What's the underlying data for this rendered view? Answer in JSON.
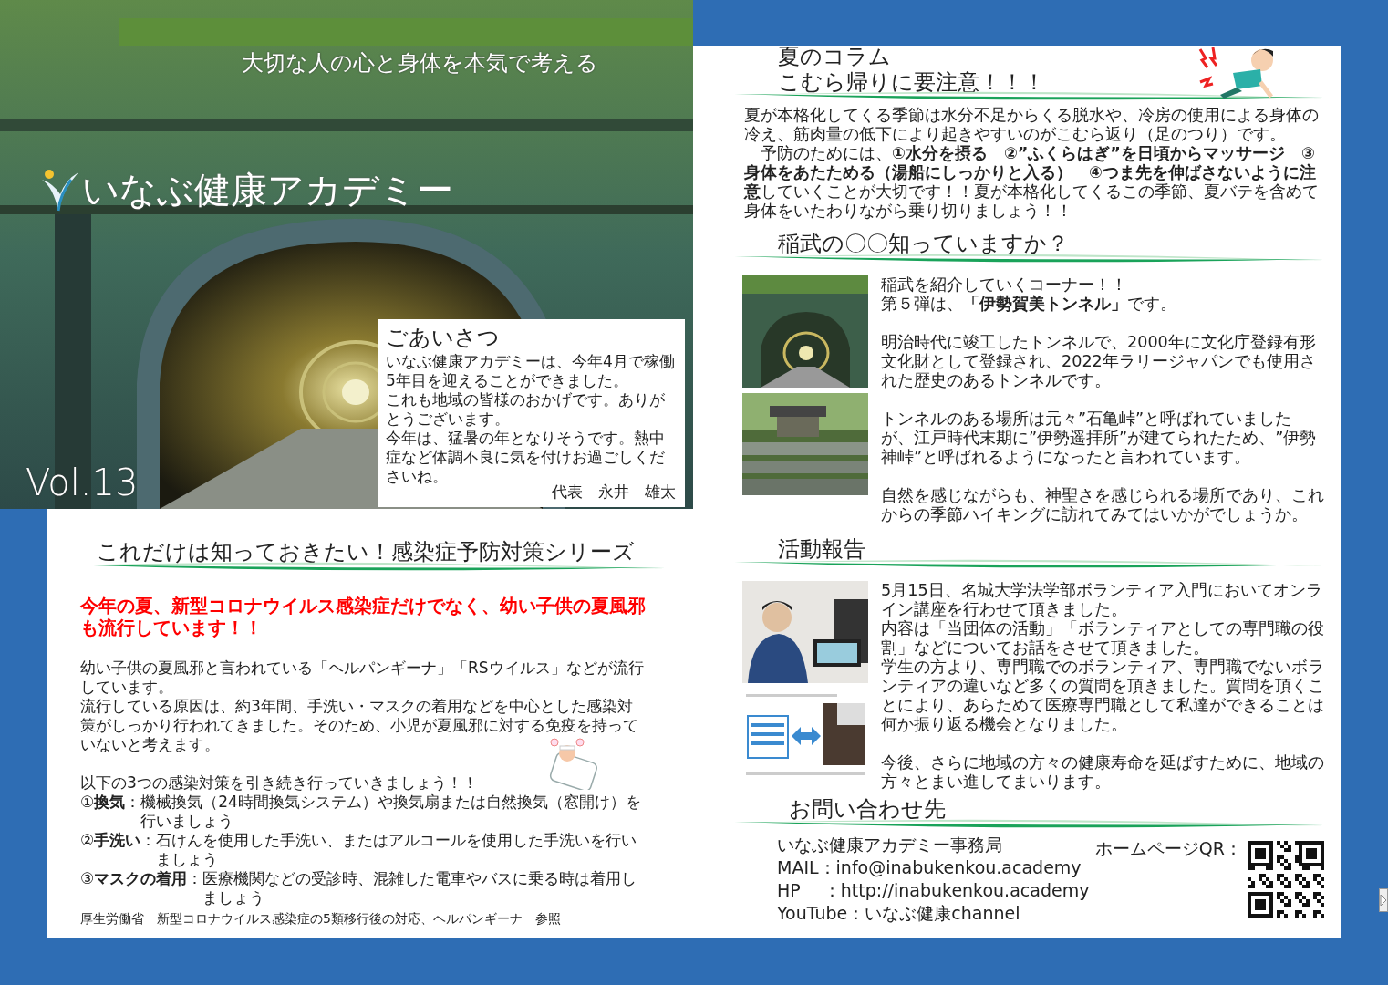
{
  "cover": {
    "tagline": "大切な人の心と身体を本気で考える",
    "title": "いなぶ健康アカデミー",
    "volume": "Vol.13",
    "greeting": {
      "title": "ごあいさつ",
      "paragraphs": [
        "いなぶ健康アカデミーは、今年4月で稼働5年目を迎えることができました。",
        "これも地域の皆様のおかげです。ありがとうございます。",
        "今年は、猛暑の年となりそうです。熱中症など体調不良に気を付けお過ごしくださいね。"
      ],
      "signature": "代表　永井　雄太"
    }
  },
  "infection_series": {
    "heading": "これだけは知っておきたい！感染症予防対策シリーズ",
    "alert": "今年の夏、新型コロナウイルス感染症だけでなく、幼い子供の夏風邪も流行しています！！",
    "paragraphs": [
      "幼い子供の夏風邪と言われている「ヘルパンギーナ」「RSウイルス」などが流行しています。",
      "流行している原因は、約3年間、手洗い・マスクの着用などを中心とした感染対策がしっかり行われてきました。そのため、小児が夏風邪に対する免疫を持っていないと考えます。"
    ],
    "list_intro": "以下の3つの感染対策を引き続き行っていきましょう！！",
    "measures": [
      {
        "label": "①**換気**：",
        "text": "機械換気（24時間換気システム）や換気扇または自然換気（窓開け）を行いましょう"
      },
      {
        "label": "②**手洗い**：",
        "text": "石けんを使用した手洗い、またはアルコールを使用した手洗いを行いましょう"
      },
      {
        "label": "③**マスクの着用**：",
        "text": "医療機関などの受診時、混雑した電車やバスに乗る時は着用しましょう"
      }
    ],
    "source": "厚生労働省　新型コロナウイルス感染症の5類移行後の対応、ヘルパンギーナ　参照"
  },
  "summer_column": {
    "heading_lines": [
      "夏のコラム",
      "こむら帰りに要注意！！！"
    ],
    "paragraphs": [
      "夏が本格化してくる季節は水分不足からくる脱水や、冷房の使用による身体の冷え、筋肉量の低下により起きやすいのがこむら返り（足のつり）です。",
      "　予防のためには、**①水分を摂る　②”ふくらはぎ”を日頃からマッサージ　③身体をあたためる（湯船にしっかりと入る）　④つま先を伸ばさないように注意**していくことが大切です！！夏が本格化してくるこの季節、夏バテを含めて身体をいたわりながら乗り切りましょう！！"
    ]
  },
  "inabu": {
    "heading": "稲武の〇〇知っていますか？",
    "paragraphs": [
      [
        "稲武を紹介していくコーナー！！",
        "第５弾は、**「伊勢賀美トンネル」**です。"
      ],
      [
        "明治時代に竣工したトンネルで、2000年に文化庁登録有形文化財として登録され、2022年ラリージャパンでも使用された歴史のあるトンネルです。"
      ],
      [
        "トンネルのある場所は元々”石亀峠”と呼ばれていましたが、江戸時代末期に”伊勢遥拝所”が建てられたため、”伊勢神峠”と呼ばれるようになったと言われています。"
      ],
      [
        "自然を感じながらも、神聖さを感じられる場所であり、これからの季節ハイキングに訪れてみてはいかがでしょうか。"
      ]
    ]
  },
  "activity": {
    "heading": "活動報告",
    "paragraphs": [
      [
        "5月15日、名城大学法学部ボランティア入門においてオンライン講座を行わせて頂きました。",
        "内容は「当団体の活動」「ボランティアとしての専門職の役割」などについてお話をさせて頂きました。",
        "学生の方より、専門職でのボランティア、専門職でないボランティアの違いなど多くの質問を頂きました。質問を頂くことにより、あらためて医療専門職として私達ができることは何か振り返る機会となりました。"
      ],
      [
        "今後、さらに地域の方々の健康寿命を延ばすために、地域の方々とまい進してまいります。"
      ]
    ]
  },
  "contact": {
    "heading": "お問い合わせ先",
    "lines": [
      "いなぶ健康アカデミー事務局",
      "MAIL：info@inabukenkou.academy",
      "HP　 ：http://inabukenkou.academy",
      "YouTube：いなぶ健康channel"
    ],
    "qr_label": "ホームページQR："
  }
}
